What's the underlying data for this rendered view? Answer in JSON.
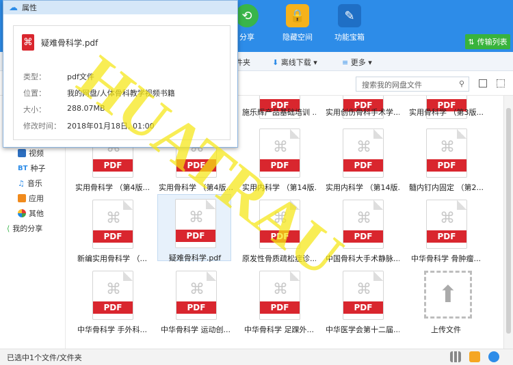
{
  "topbar": {
    "buttons": [
      {
        "label": "分享"
      },
      {
        "label": "隐藏空间"
      },
      {
        "label": "功能宝箱"
      }
    ],
    "transfer": "传输列表"
  },
  "toolbar": {
    "folder": "件夹",
    "offline": "离线下载",
    "more": "更多"
  },
  "search": {
    "placeholder": "搜索我的网盘文件"
  },
  "sidebar": {
    "items": [
      {
        "label": "视频"
      },
      {
        "label": "种子"
      },
      {
        "label": "音乐"
      },
      {
        "label": "应用"
      },
      {
        "label": "其他"
      },
      {
        "label": "我的分享"
      }
    ]
  },
  "files": {
    "row0": [
      {
        "name": "施乐辉产品基础培训 ..."
      },
      {
        "name": "实用创伤骨科手术学..."
      },
      {
        "name": "实用骨科学 （第3版..."
      }
    ],
    "row1": [
      {
        "name": "实用骨科学 （第4版..."
      },
      {
        "name": "实用骨科学 （第4版..."
      },
      {
        "name": "实用内科学 （第14版..."
      },
      {
        "name": "实用内科学 （第14版..."
      },
      {
        "name": "髓内钉内固定 （第2..."
      }
    ],
    "row2": [
      {
        "name": "新编实用骨科学 （..."
      },
      {
        "name": "疑难骨科学.pdf"
      },
      {
        "name": "原发性骨质疏松症诊..."
      },
      {
        "name": "中国骨科大手术静脉..."
      },
      {
        "name": "中华骨科学 骨肿瘤..."
      }
    ],
    "row3": [
      {
        "name": "中华骨科学 手外科..."
      },
      {
        "name": "中华骨科学 运动创..."
      },
      {
        "name": "中华骨科学 足踝外..."
      },
      {
        "name": "中华医学会第十二届..."
      }
    ],
    "pdf_label": "PDF",
    "upload_label": "上传文件"
  },
  "status": {
    "text": "已选中1个文件/文件夹"
  },
  "dialog": {
    "title": "属性",
    "filename": "疑难骨科学.pdf",
    "rows": [
      {
        "key": "类型：",
        "value": "pdf文件"
      },
      {
        "key": "位置：",
        "value": "我的网盘/人体骨科教学视频书籍"
      },
      {
        "key": "大小：",
        "value": "288.07MB"
      },
      {
        "key": "修改时间：",
        "value": "2018年01月18日, 01:00"
      }
    ]
  },
  "watermark": "HUATRAU",
  "colors": {
    "topbar": "#2d8ce8",
    "pdf_red": "#d9262e",
    "transfer_green": "#38b33c",
    "watermark": "#f5e614"
  }
}
